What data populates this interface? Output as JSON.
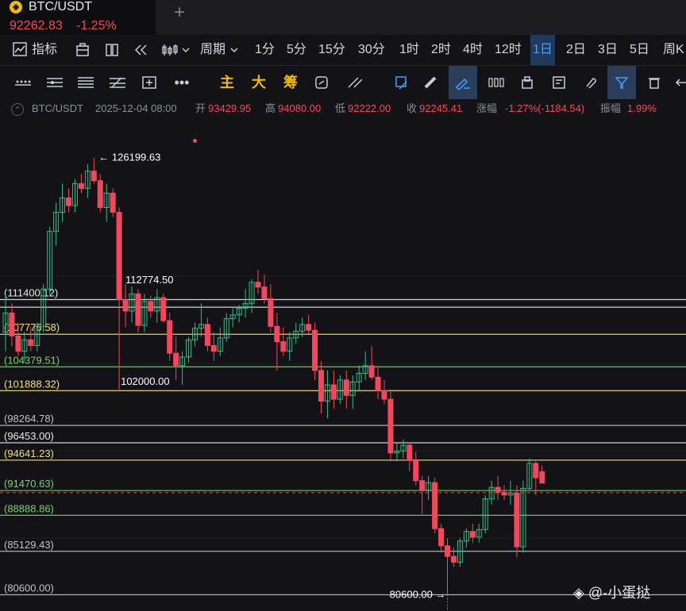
{
  "tab": {
    "symbol": "BTC/USDT",
    "price": "92262.83",
    "change": "-1.25%",
    "logo_icon": "binance-logo-icon",
    "add_label": "+"
  },
  "toolbar": {
    "indicators_label": "指标",
    "period_label": "周期",
    "intervals": [
      "1分",
      "5分",
      "15分",
      "30分",
      "1时",
      "2时",
      "4时",
      "12时",
      "1日",
      "2日",
      "3日",
      "5日",
      "周K"
    ],
    "active_interval": "1日"
  },
  "drawing_tools": {
    "main_label": "主",
    "big_label": "大",
    "chip_label": "筹"
  },
  "info": {
    "symbol": "BTC/USDT",
    "date": "2025-12-04 08:00",
    "open_label": "开",
    "open": "93429.95",
    "high_label": "高",
    "high": "94080.00",
    "low_label": "低",
    "low": "92222.00",
    "close_label": "收",
    "close": "92245.41",
    "chg_label": "涨幅",
    "chg": "-1.27%(-1184.54)",
    "amp_label": "振幅",
    "amp": "1.99%"
  },
  "chart_data": {
    "type": "candlestick",
    "ylim": [
      78900,
      130400
    ],
    "candles": [
      {
        "o": 108000,
        "h": 112000,
        "l": 106000,
        "c": 110000
      },
      {
        "o": 110000,
        "h": 111000,
        "l": 106500,
        "c": 107600
      },
      {
        "o": 107600,
        "h": 109000,
        "l": 105500,
        "c": 106000
      },
      {
        "o": 106000,
        "h": 108000,
        "l": 105000,
        "c": 107200
      },
      {
        "o": 107200,
        "h": 108500,
        "l": 106000,
        "c": 106600
      },
      {
        "o": 106600,
        "h": 109000,
        "l": 106000,
        "c": 108600
      },
      {
        "o": 108600,
        "h": 113000,
        "l": 108000,
        "c": 112500
      },
      {
        "o": 112500,
        "h": 119000,
        "l": 112000,
        "c": 118500
      },
      {
        "o": 118500,
        "h": 121500,
        "l": 117000,
        "c": 120500
      },
      {
        "o": 120500,
        "h": 123500,
        "l": 119500,
        "c": 122000
      },
      {
        "o": 122000,
        "h": 123000,
        "l": 120500,
        "c": 121200
      },
      {
        "o": 121200,
        "h": 124000,
        "l": 120500,
        "c": 123500
      },
      {
        "o": 123500,
        "h": 124500,
        "l": 122500,
        "c": 123000
      },
      {
        "o": 123000,
        "h": 125500,
        "l": 122000,
        "c": 124800
      },
      {
        "o": 124800,
        "h": 126199.63,
        "l": 123500,
        "c": 123800
      },
      {
        "o": 123800,
        "h": 124500,
        "l": 120500,
        "c": 121000
      },
      {
        "o": 121000,
        "h": 123500,
        "l": 119500,
        "c": 122500
      },
      {
        "o": 122500,
        "h": 123000,
        "l": 120000,
        "c": 120500
      },
      {
        "o": 120500,
        "h": 121000,
        "l": 102000,
        "c": 111400
      },
      {
        "o": 111400,
        "h": 113000,
        "l": 108500,
        "c": 110200
      },
      {
        "o": 110200,
        "h": 112774.5,
        "l": 109000,
        "c": 112000
      },
      {
        "o": 112000,
        "h": 112500,
        "l": 108000,
        "c": 108700
      },
      {
        "o": 108700,
        "h": 112000,
        "l": 108000,
        "c": 111200
      },
      {
        "o": 111200,
        "h": 111800,
        "l": 109500,
        "c": 110200
      },
      {
        "o": 110200,
        "h": 112500,
        "l": 109000,
        "c": 111600
      },
      {
        "o": 111600,
        "h": 112000,
        "l": 109000,
        "c": 109200
      },
      {
        "o": 109200,
        "h": 110000,
        "l": 105000,
        "c": 105800
      },
      {
        "o": 105800,
        "h": 107500,
        "l": 103000,
        "c": 104500
      },
      {
        "o": 104500,
        "h": 106000,
        "l": 102500,
        "c": 105400
      },
      {
        "o": 105400,
        "h": 107500,
        "l": 104800,
        "c": 107200
      },
      {
        "o": 107200,
        "h": 109000,
        "l": 106500,
        "c": 108400
      },
      {
        "o": 108400,
        "h": 111000,
        "l": 107500,
        "c": 108800
      },
      {
        "o": 108800,
        "h": 109500,
        "l": 106000,
        "c": 106600
      },
      {
        "o": 106600,
        "h": 108000,
        "l": 105000,
        "c": 106000
      },
      {
        "o": 106000,
        "h": 108500,
        "l": 105500,
        "c": 107400
      },
      {
        "o": 107400,
        "h": 110000,
        "l": 107000,
        "c": 109400
      },
      {
        "o": 109400,
        "h": 110500,
        "l": 108500,
        "c": 109800
      },
      {
        "o": 109800,
        "h": 110800,
        "l": 109000,
        "c": 110500
      },
      {
        "o": 110500,
        "h": 112500,
        "l": 109500,
        "c": 111000
      },
      {
        "o": 111000,
        "h": 113500,
        "l": 110000,
        "c": 113200
      },
      {
        "o": 113200,
        "h": 114500,
        "l": 112000,
        "c": 112700
      },
      {
        "o": 112700,
        "h": 114000,
        "l": 111000,
        "c": 111500
      },
      {
        "o": 111500,
        "h": 113000,
        "l": 108000,
        "c": 108600
      },
      {
        "o": 108600,
        "h": 110000,
        "l": 104000,
        "c": 107000
      },
      {
        "o": 107000,
        "h": 108500,
        "l": 105500,
        "c": 106000
      },
      {
        "o": 106000,
        "h": 108000,
        "l": 105000,
        "c": 107400
      },
      {
        "o": 107400,
        "h": 109000,
        "l": 106800,
        "c": 108100
      },
      {
        "o": 108100,
        "h": 109500,
        "l": 107500,
        "c": 108800
      },
      {
        "o": 108800,
        "h": 109800,
        "l": 107800,
        "c": 108200
      },
      {
        "o": 108200,
        "h": 109000,
        "l": 103000,
        "c": 104000
      },
      {
        "o": 104000,
        "h": 105000,
        "l": 99500,
        "c": 100800
      },
      {
        "o": 100800,
        "h": 104000,
        "l": 99000,
        "c": 102500
      },
      {
        "o": 102500,
        "h": 104000,
        "l": 100000,
        "c": 101000
      },
      {
        "o": 101000,
        "h": 103500,
        "l": 100500,
        "c": 103000
      },
      {
        "o": 103000,
        "h": 104000,
        "l": 100000,
        "c": 101400
      },
      {
        "o": 101400,
        "h": 103500,
        "l": 100000,
        "c": 102800
      },
      {
        "o": 102800,
        "h": 104500,
        "l": 101800,
        "c": 103700
      },
      {
        "o": 103700,
        "h": 106000,
        "l": 103000,
        "c": 104500
      },
      {
        "o": 104500,
        "h": 106500,
        "l": 103000,
        "c": 103300
      },
      {
        "o": 103300,
        "h": 104500,
        "l": 101000,
        "c": 101900
      },
      {
        "o": 101900,
        "h": 103000,
        "l": 100500,
        "c": 101000
      },
      {
        "o": 101000,
        "h": 102000,
        "l": 94500,
        "c": 95400
      },
      {
        "o": 95400,
        "h": 96500,
        "l": 94500,
        "c": 95600
      },
      {
        "o": 95600,
        "h": 96800,
        "l": 94800,
        "c": 96200
      },
      {
        "o": 96200,
        "h": 96500,
        "l": 93500,
        "c": 94600
      },
      {
        "o": 94600,
        "h": 95500,
        "l": 92000,
        "c": 92500
      },
      {
        "o": 92500,
        "h": 93000,
        "l": 89000,
        "c": 91500
      },
      {
        "o": 91500,
        "h": 93000,
        "l": 90500,
        "c": 92300
      },
      {
        "o": 92300,
        "h": 92800,
        "l": 87000,
        "c": 87500
      },
      {
        "o": 87500,
        "h": 88000,
        "l": 85000,
        "c": 85700
      },
      {
        "o": 85700,
        "h": 86500,
        "l": 80600,
        "c": 84600
      },
      {
        "o": 84600,
        "h": 85500,
        "l": 83500,
        "c": 84000
      },
      {
        "o": 84000,
        "h": 86500,
        "l": 83500,
        "c": 86200
      },
      {
        "o": 86200,
        "h": 87500,
        "l": 85500,
        "c": 87200
      },
      {
        "o": 87200,
        "h": 88000,
        "l": 86000,
        "c": 86600
      },
      {
        "o": 86600,
        "h": 88000,
        "l": 86000,
        "c": 87400
      },
      {
        "o": 87400,
        "h": 91000,
        "l": 87000,
        "c": 90600
      },
      {
        "o": 90600,
        "h": 92500,
        "l": 90000,
        "c": 91800
      },
      {
        "o": 91800,
        "h": 93000,
        "l": 90500,
        "c": 91300
      },
      {
        "o": 91300,
        "h": 92000,
        "l": 90500,
        "c": 91000
      },
      {
        "o": 91000,
        "h": 92500,
        "l": 90000,
        "c": 91200
      },
      {
        "o": 91200,
        "h": 92000,
        "l": 84500,
        "c": 85600
      },
      {
        "o": 85600,
        "h": 92500,
        "l": 85000,
        "c": 91700
      },
      {
        "o": 91700,
        "h": 94800,
        "l": 91500,
        "c": 94300
      },
      {
        "o": 94300,
        "h": 94500,
        "l": 91000,
        "c": 92800
      },
      {
        "o": 93429.95,
        "h": 94080,
        "l": 92222,
        "c": 92245.41
      }
    ],
    "levels": [
      {
        "value": 111400.12,
        "label": "(111400.12)",
        "color": "#e8e8e8"
      },
      {
        "value": 110600,
        "label": "",
        "color": "#e8e8e8"
      },
      {
        "value": 107776.58,
        "label": "(107776.58)",
        "color": "#f3e26a"
      },
      {
        "value": 104379.51,
        "label": "(104379.51)",
        "color": "#7fd16b"
      },
      {
        "value": 101888.32,
        "label": "(101888.32)",
        "color": "#f3e26a"
      },
      {
        "value": 98264.78,
        "label": "(98264.78)",
        "color": "#c4c4c4"
      },
      {
        "value": 96453.0,
        "label": "(96453.00)",
        "color": "#e8e8e8"
      },
      {
        "value": 94641.23,
        "label": "(94641.23)",
        "color": "#f3e26a"
      },
      {
        "value": 91470.63,
        "label": "(91470.63)",
        "color": "#7fd16b"
      },
      {
        "value": 88888.86,
        "label": "(88888.86)",
        "color": "#7fd16b"
      },
      {
        "value": 85129.43,
        "label": "(85129.43)",
        "color": "#c4c4c4"
      },
      {
        "value": 80600.0,
        "label": "(80600.00)",
        "color": "#c4c4c4"
      }
    ],
    "annotations": [
      {
        "value": 126199.63,
        "label": "← 126199.63",
        "index": 14
      },
      {
        "value": 112774.5,
        "label": "112774.50",
        "index": 20
      },
      {
        "value": 102000.0,
        "label": "102000.00",
        "index": 18
      },
      {
        "value": 80600.0,
        "label": "80600.00 →",
        "index": 70
      }
    ],
    "last_price": 92245.41,
    "up_color": "#2ebd85",
    "down_color": "#f6465d"
  },
  "watermark": {
    "text": "◈ @-小蛋挞"
  }
}
